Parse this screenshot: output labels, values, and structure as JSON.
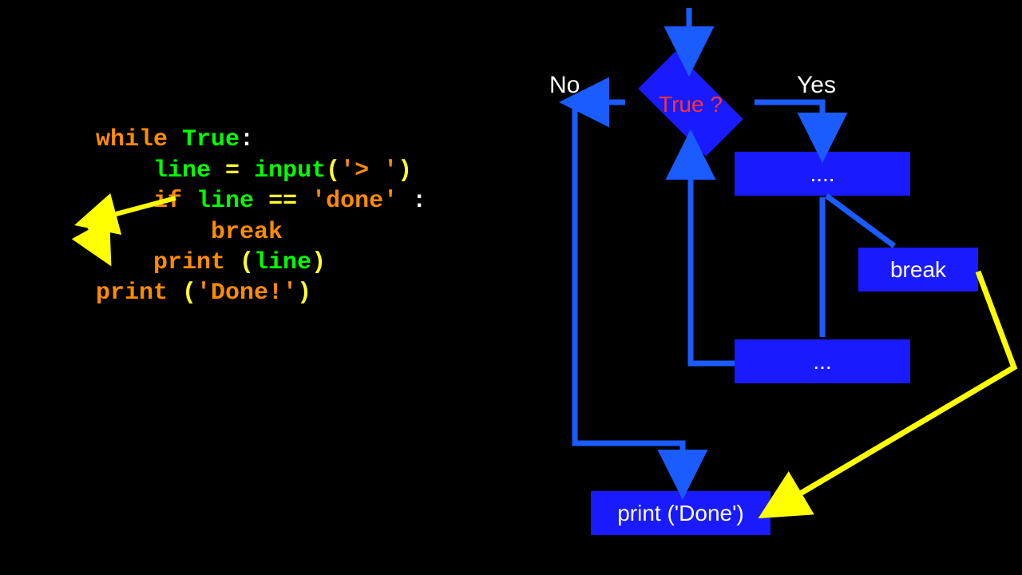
{
  "code": {
    "l1_while": "while",
    "l1_true": "True",
    "l1_colon": ":",
    "l2_line": "line",
    "l2_eq": "=",
    "l2_input": "input",
    "l2_paren_open": "(",
    "l2_prompt": "'> '",
    "l2_paren_close": ")",
    "l3_if": "if",
    "l3_line": "line",
    "l3_eqeq": "==",
    "l3_done": "'done'",
    "l3_colon": " :",
    "l4_break": "break",
    "l5_print": "print",
    "l5_po": " (",
    "l5_arg": "line",
    "l5_pc": ")",
    "l6_print": "print",
    "l6_po": " (",
    "l6_arg": "'Done!'",
    "l6_pc": ")"
  },
  "flowchart": {
    "label_no": "No",
    "label_yes": "Yes",
    "diamond": "True ?",
    "box_dots1": "....",
    "box_break": "break",
    "box_dots2": "...",
    "box_done": "print ('Done')"
  }
}
